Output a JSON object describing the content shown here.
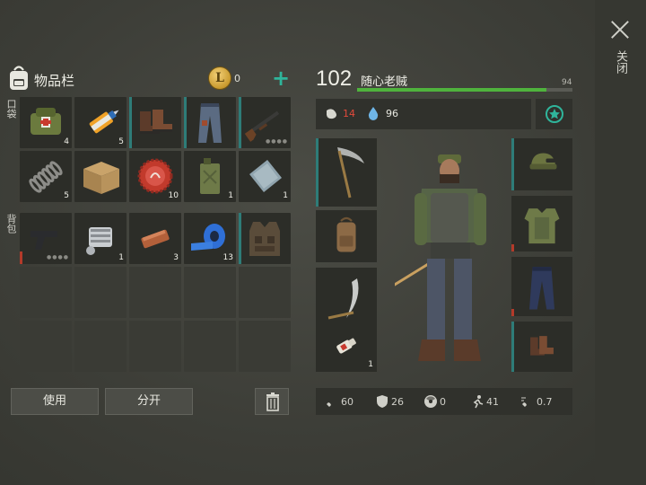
{
  "close": {
    "label": "关闭"
  },
  "inventory": {
    "title": "物品栏",
    "coins": "0",
    "pockets_label": "口袋",
    "backpack_label": "背包",
    "pocket_slots": [
      {
        "item": "first-aid-bag",
        "count": "4"
      },
      {
        "item": "glue-tube",
        "count": "5"
      },
      {
        "item": "boots",
        "count": ""
      },
      {
        "item": "pants",
        "count": ""
      },
      {
        "item": "shotgun",
        "count": ""
      },
      {
        "item": "spring",
        "count": "5"
      },
      {
        "item": "cardboard-box",
        "count": ""
      },
      {
        "item": "bottle-cap",
        "count": "10"
      },
      {
        "item": "fuel-can",
        "count": "1"
      },
      {
        "item": "metal-sheet",
        "count": "1"
      }
    ],
    "backpack_slots": [
      {
        "item": "pistol",
        "count": ""
      },
      {
        "item": "engine-part",
        "count": "1"
      },
      {
        "item": "copper-bar",
        "count": "3"
      },
      {
        "item": "duct-tape",
        "count": "13"
      },
      {
        "item": "tactical-vest",
        "count": ""
      }
    ],
    "use_button": "使用",
    "split_button": "分开"
  },
  "character": {
    "level": "102",
    "name": "随心老贼",
    "hp": "94",
    "hp_fraction": 0.88,
    "food": "14",
    "water": "96"
  },
  "equipment": {
    "left": [
      {
        "item": "scythe-blade",
        "count": ""
      },
      {
        "item": "backpack",
        "count": ""
      },
      {
        "item": "scythe",
        "count": ""
      },
      {
        "item": "bandage-pills",
        "count": "1"
      }
    ],
    "right": [
      {
        "item": "camo-hat"
      },
      {
        "item": "camo-jacket"
      },
      {
        "item": "jeans"
      },
      {
        "item": "boots"
      }
    ]
  },
  "bottom_stats": {
    "attack": "60",
    "defense": "26",
    "radiation": "0",
    "speed": "41",
    "attack_speed": "0.7"
  },
  "colors": {
    "accent": "#2fb59b",
    "hp_green": "#4fb33d",
    "food_red": "#e24a3b"
  }
}
